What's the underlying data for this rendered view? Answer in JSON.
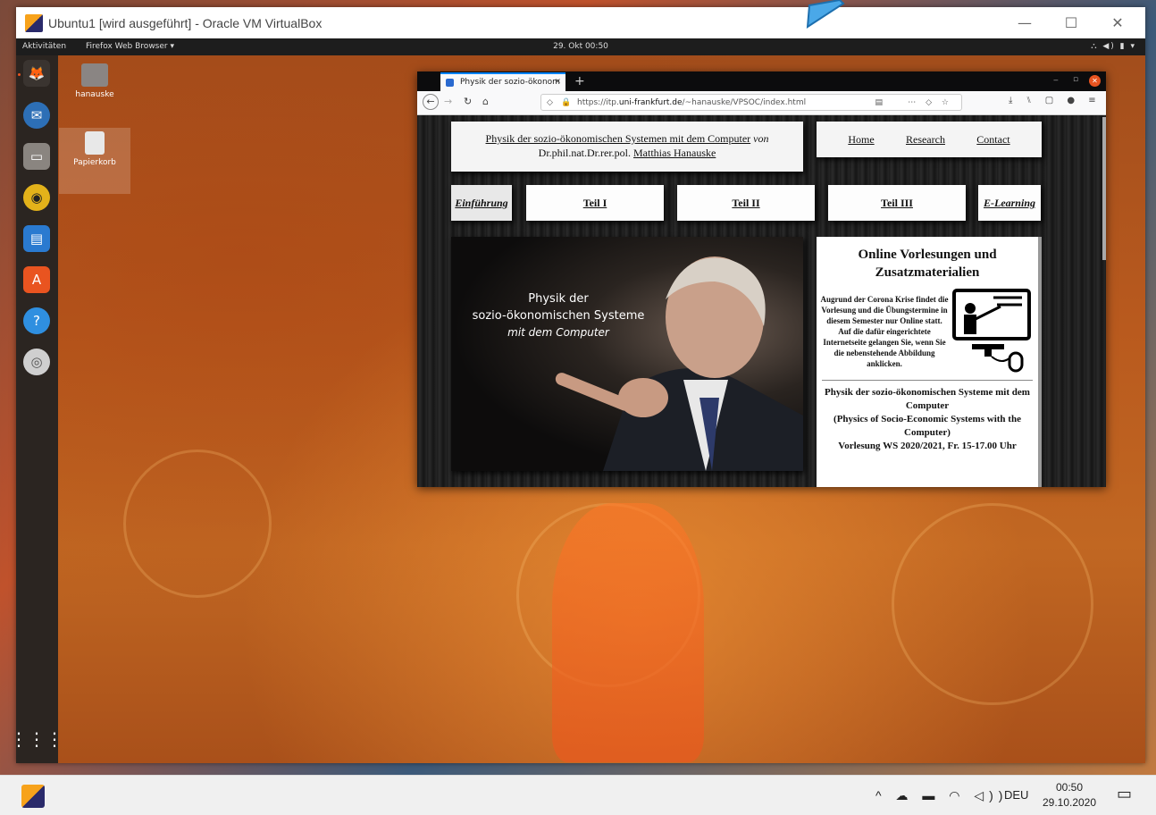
{
  "host_window": {
    "title": "Ubuntu1 [wird ausgeführt] - Oracle VM VirtualBox",
    "controls": [
      "—",
      "☐",
      "✕"
    ]
  },
  "ubuntu_topbar": {
    "activities": "Aktivitäten",
    "app_menu": "Firefox Web Browser ▾",
    "clock": "29. Okt  00:50",
    "tray": "⛬ ◀) ▮ ▾"
  },
  "desktop_icons": [
    {
      "label": "hanauske",
      "icon": "home-folder-icon"
    },
    {
      "label": "Papierkorb",
      "icon": "trash-icon"
    }
  ],
  "dock": [
    {
      "name": "firefox",
      "glyph": "🦊"
    },
    {
      "name": "thunderbird",
      "glyph": "✉"
    },
    {
      "name": "files",
      "glyph": "▭"
    },
    {
      "name": "rhythmbox",
      "glyph": "◉"
    },
    {
      "name": "writer",
      "glyph": "▤"
    },
    {
      "name": "software",
      "glyph": "A"
    },
    {
      "name": "help",
      "glyph": "?"
    },
    {
      "name": "disc",
      "glyph": "◎"
    }
  ],
  "browser": {
    "tab_title": "Physik der sozio-ökonom",
    "tab_close": "✕",
    "new_tab": "+",
    "url_host": "https://itp.uni-frankfurt.de",
    "url_path": "/~hanauske/VPSOC/index.html",
    "url_full_prefix": "https://itp.",
    "url_domain": "uni-frankfurt.de",
    "url_rest": "/~hanauske/VPSOC/index.html",
    "toolbar_right": "⋯ ◇ ☆",
    "toolbar_far": "⤓ ⑊ ▢ ● ≡"
  },
  "page": {
    "title_link": "Physik der sozio-ökonomischen Systemen mit dem Computer",
    "title_von": "von",
    "title_author_prefix": "Dr.phil.nat.Dr.rer.pol.",
    "title_author": "Matthias Hanauske",
    "nav": [
      "Home",
      "Research",
      "Contact"
    ],
    "tabs": [
      "Einführung",
      "Teil I",
      "Teil II",
      "Teil III",
      "E-Learning"
    ],
    "hero_line1": "Physik der",
    "hero_line2": "sozio-ökonomischen Systeme",
    "hero_line3": "mit dem Computer",
    "side_heading": "Online Vorlesungen und Zusatzmaterialien",
    "side_text": "Augrund der Corona Krise findet die Vorlesung und die Übungstermine in diesem Semester nur Online statt. Auf die dafür eingerichtete Internetseite gelangen Sie, wenn Sie die nebenstehende Abbildung anklicken.",
    "side_course_1": "Physik der sozio-ökonomischen Systeme mit dem Computer",
    "side_course_2": "(Physics of Socio-Economic Systems with the Computer)",
    "side_course_3": "Vorlesung WS 2020/2021, Fr. 15-17.00 Uhr"
  },
  "taskbar": {
    "tray_icons": "^ ☁ ▬ ◠ ◁))",
    "language": "DEU",
    "time": "00:50",
    "date": "29.10.2020",
    "notification": "▭"
  }
}
